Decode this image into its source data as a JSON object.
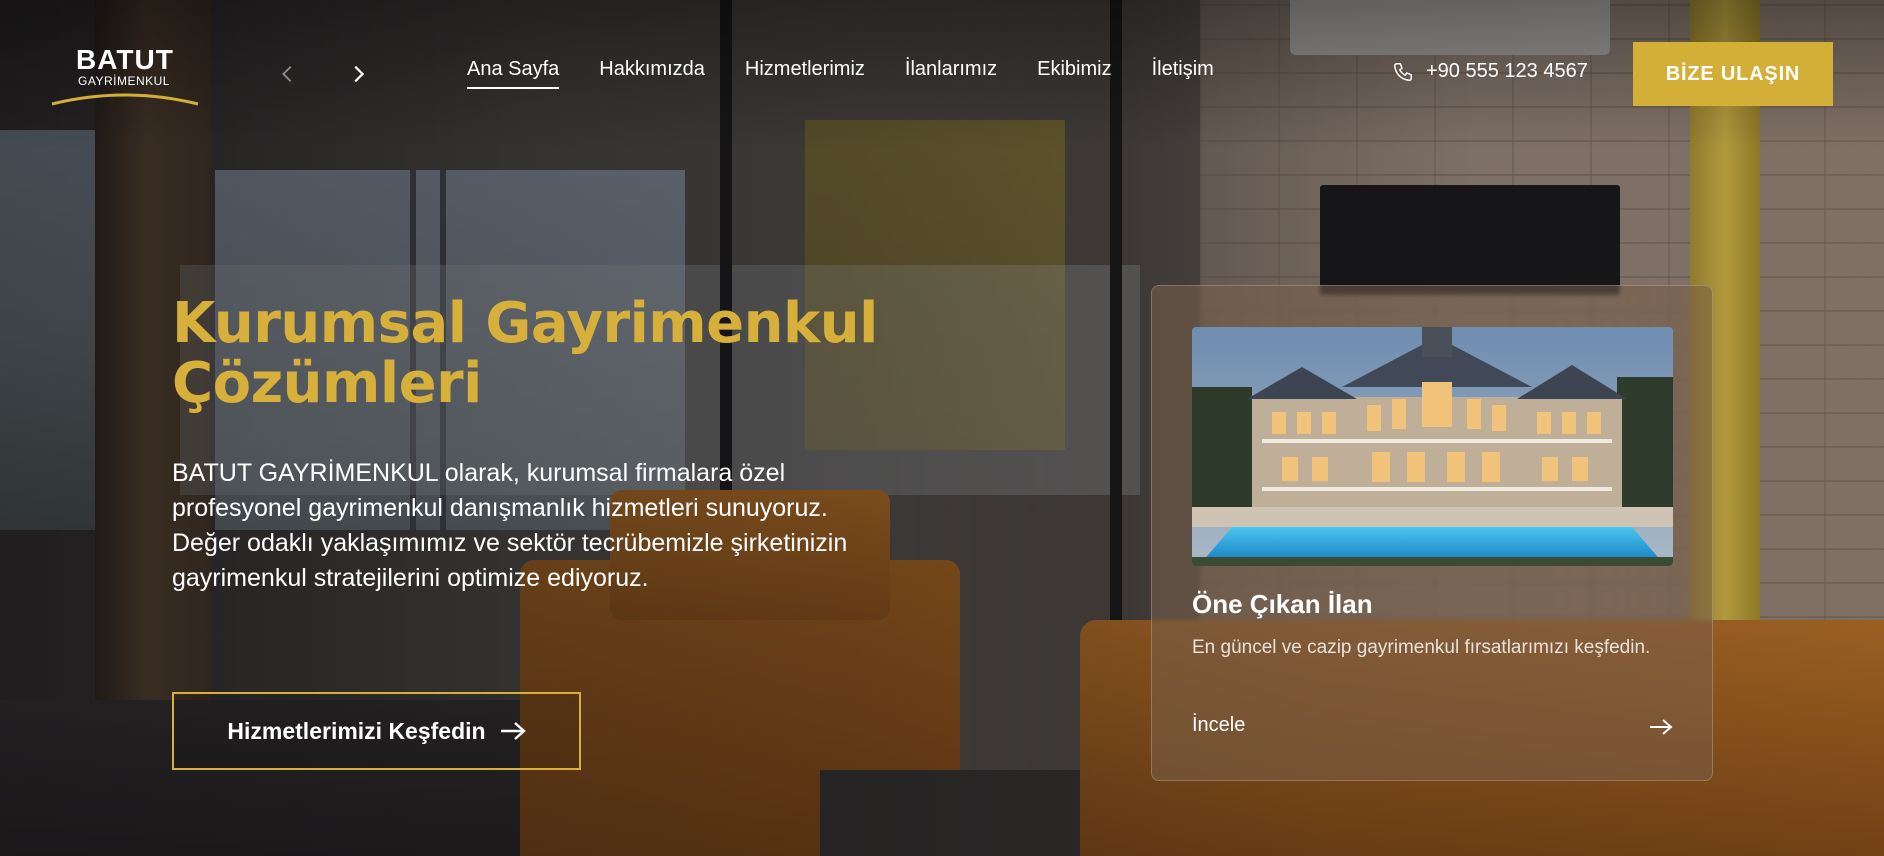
{
  "brand": {
    "name": "BATUT",
    "tagline": "GAYRİMENKUL",
    "accent_color": "#d4af37"
  },
  "nav": {
    "prev_icon": "chevron-left-icon",
    "next_icon": "chevron-right-icon",
    "items": [
      {
        "label": "Ana Sayfa",
        "active": true
      },
      {
        "label": "Hakkımızda",
        "active": false
      },
      {
        "label": "Hizmetlerimiz",
        "active": false
      },
      {
        "label": "İlanlarımız",
        "active": false
      },
      {
        "label": "Ekibimiz",
        "active": false
      },
      {
        "label": "İletişim",
        "active": false
      }
    ]
  },
  "contact": {
    "phone_icon": "phone-icon",
    "phone": "+90 555 123 4567",
    "cta_label": "BİZE ULAŞIN"
  },
  "hero": {
    "title": "Kurumsal Gayrimenkul Çözümleri",
    "description": "BATUT GAYRİMENKUL olarak, kurumsal firmalara özel profesyonel gayrimenkul danışmanlık hizmetleri sunuyoruz. Değer odaklı yaklaşımımız ve sektör tecrübemizle şirketinizin gayrimenkul stratejilerini optimize ediyoruz.",
    "button_label": "Hizmetlerimizi Keşfedin",
    "button_icon": "arrow-right-icon"
  },
  "featured": {
    "image_alt": "mansion-with-pool",
    "title": "Öne Çıkan İlan",
    "text": "En güncel ve cazip gayrimenkul fırsatlarımızı keşfedin.",
    "link_label": "İncele",
    "link_icon": "arrow-right-icon"
  }
}
